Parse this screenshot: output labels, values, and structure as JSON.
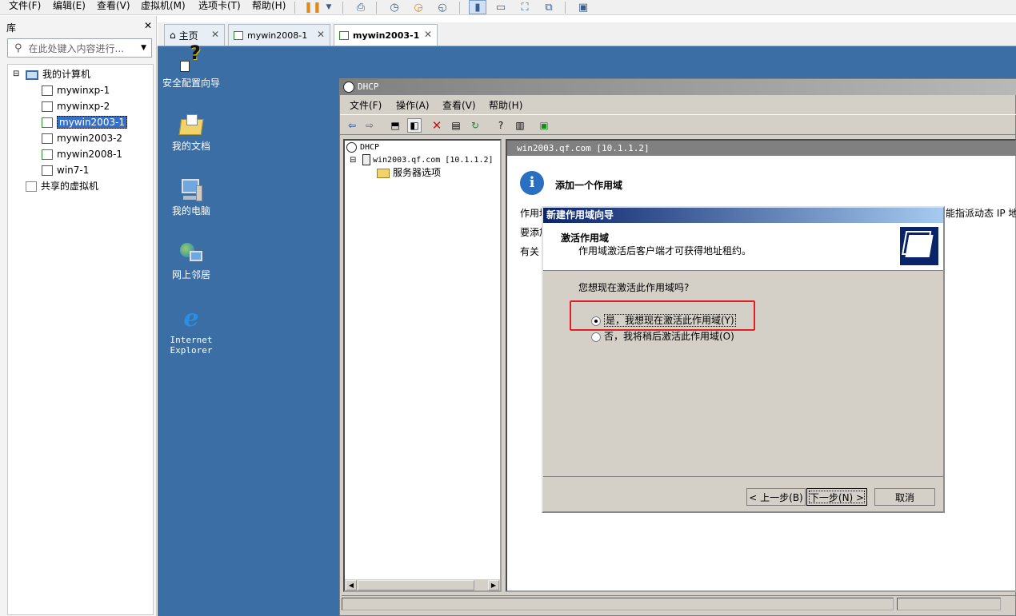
{
  "menubar": {
    "items": [
      "文件(F)",
      "编辑(E)",
      "查看(V)",
      "虚拟机(M)",
      "选项卡(T)",
      "帮助(H)"
    ]
  },
  "library": {
    "title": "库",
    "close": "✕",
    "search_placeholder": "在此处键入内容进行...",
    "tree": {
      "root": "我的计算机",
      "vms": [
        "mywinxp-1",
        "mywinxp-2",
        "mywin2003-1",
        "mywin2003-2",
        "mywin2008-1",
        "win7-1"
      ],
      "selected": "mywin2003-1",
      "shared": "共享的虚拟机"
    }
  },
  "tabs": [
    {
      "label": "主页",
      "close": "✕"
    },
    {
      "label": "mywin2008-1",
      "close": "✕"
    },
    {
      "label": "mywin2003-1",
      "close": "✕",
      "active": true
    }
  ],
  "desktop_icons": [
    {
      "label": "安全配置向导",
      "icon": "security-wizard-icon"
    },
    {
      "label": "我的文档",
      "icon": "documents-folder-icon"
    },
    {
      "label": "我的电脑",
      "icon": "computer-icon"
    },
    {
      "label": "网上邻居",
      "icon": "network-icon"
    },
    {
      "label": "Internet Explorer",
      "icon": "ie-icon"
    }
  ],
  "dhcp": {
    "title": "DHCP",
    "menu": [
      "文件(F)",
      "操作(A)",
      "查看(V)",
      "帮助(H)"
    ],
    "tree": {
      "root": "DHCP",
      "server": "win2003.qf.com [10.1.1.2]",
      "child": "服务器选项"
    },
    "right_header": "win2003.qf.com [10.1.1.2]",
    "info_title": "添加一个作用域",
    "info_lines": [
      "作用域",
      "要添加",
      "有关"
    ],
    "info_fragment": "能指派动态 IP 地"
  },
  "wizard": {
    "title": "新建作用域向导",
    "heading": "激活作用域",
    "subheading": "作用域激活后客户端才可获得地址租约。",
    "question": "您想现在激活此作用域吗?",
    "option_yes": "是，我想现在激活此作用域(Y)",
    "option_no": "否，我将稍后激活此作用域(O)",
    "back": "< 上一步(B)",
    "next": "下一步(N) >",
    "cancel": "取消"
  },
  "colors": {
    "desktop": "#3a6ea5",
    "wizard_title": "#0a246a",
    "highlight": "#e02020"
  }
}
